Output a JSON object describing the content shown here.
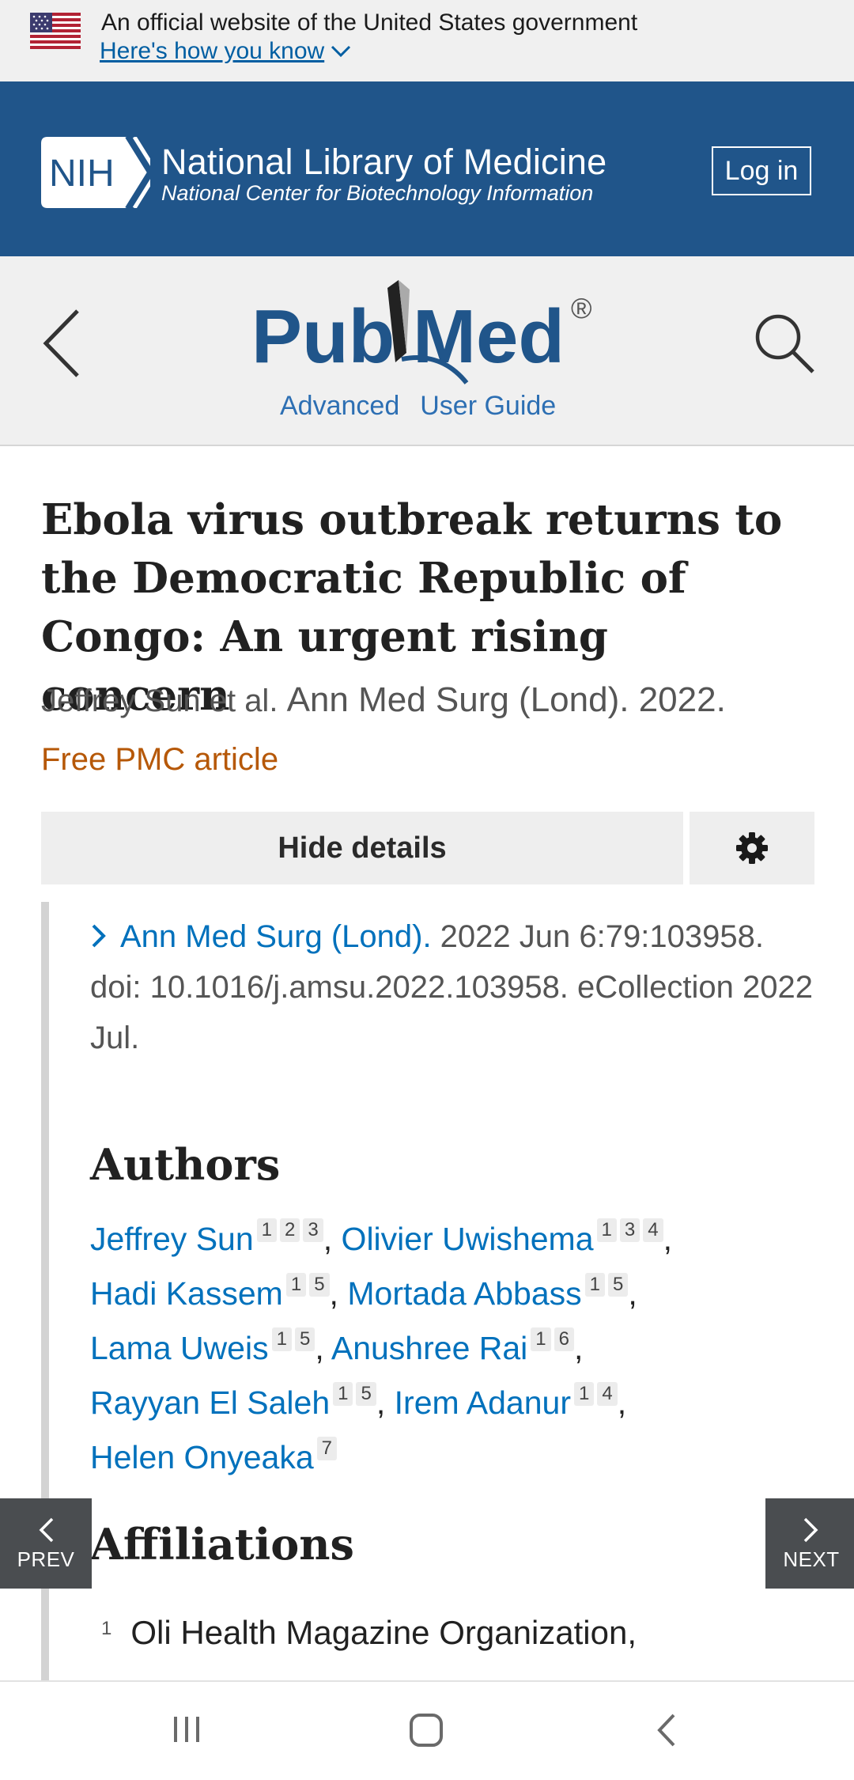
{
  "gov_banner": {
    "text": "An official website of the United States government",
    "link": "Here's how you know"
  },
  "nih": {
    "logo_text": "NIH",
    "title": "National Library of Medicine",
    "subtitle": "National Center for Biotechnology Information",
    "login": "Log in"
  },
  "pubmed": {
    "logo_pub": "Pub",
    "logo_med": "Med",
    "logo_reg": "®",
    "advanced": "Advanced",
    "user_guide": "User Guide"
  },
  "article": {
    "title": "Ebola virus outbreak returns to the Democratic Republic of Congo: An urgent rising concern",
    "authors_short": "Jeffrey Sun et al.",
    "journal_short": "Ann Med Surg (Lond). 2022.",
    "free_pmc": "Free PMC article",
    "hide_details": "Hide details",
    "journal_link": "Ann Med Surg (Lond).",
    "citation_rest": " 2022 Jun 6:79:103958. doi: 10.1016/j.amsu.2022.103958. eCollection 2022 Jul.",
    "authors_heading": "Authors",
    "affiliations_heading": "Affiliations",
    "author_lines": [
      [
        {
          "name": "Jeffrey Sun",
          "sups": [
            "1",
            "2",
            "3"
          ],
          "sep": ","
        },
        {
          "name": "Olivier Uwishema",
          "sups": [
            "1",
            "3",
            "4"
          ],
          "sep": ","
        }
      ],
      [
        {
          "name": "Hadi Kassem",
          "sups": [
            "1",
            "5"
          ],
          "sep": ","
        },
        {
          "name": "Mortada Abbass",
          "sups": [
            "1",
            "5"
          ],
          "sep": ","
        }
      ],
      [
        {
          "name": "Lama Uweis",
          "sups": [
            "1",
            "5"
          ],
          "sep": ","
        },
        {
          "name": "Anushree Rai",
          "sups": [
            "1",
            "6"
          ],
          "sep": ","
        }
      ],
      [
        {
          "name": "Rayyan El Saleh",
          "sups": [
            "1",
            "5"
          ],
          "sep": ","
        },
        {
          "name": "Irem Adanur",
          "sups": [
            "1",
            "4"
          ],
          "sep": ","
        }
      ],
      [
        {
          "name": "Helen Onyeaka",
          "sups": [
            "7"
          ],
          "sep": ""
        }
      ]
    ],
    "affiliation_1": {
      "num": "1",
      "text": "Oli Health Magazine Organization,"
    }
  },
  "nav": {
    "prev": "PREV",
    "next": "NEXT"
  },
  "colors": {
    "nih_blue": "#20558a",
    "link_blue": "#0071bc",
    "pmc_orange": "#b65808"
  }
}
